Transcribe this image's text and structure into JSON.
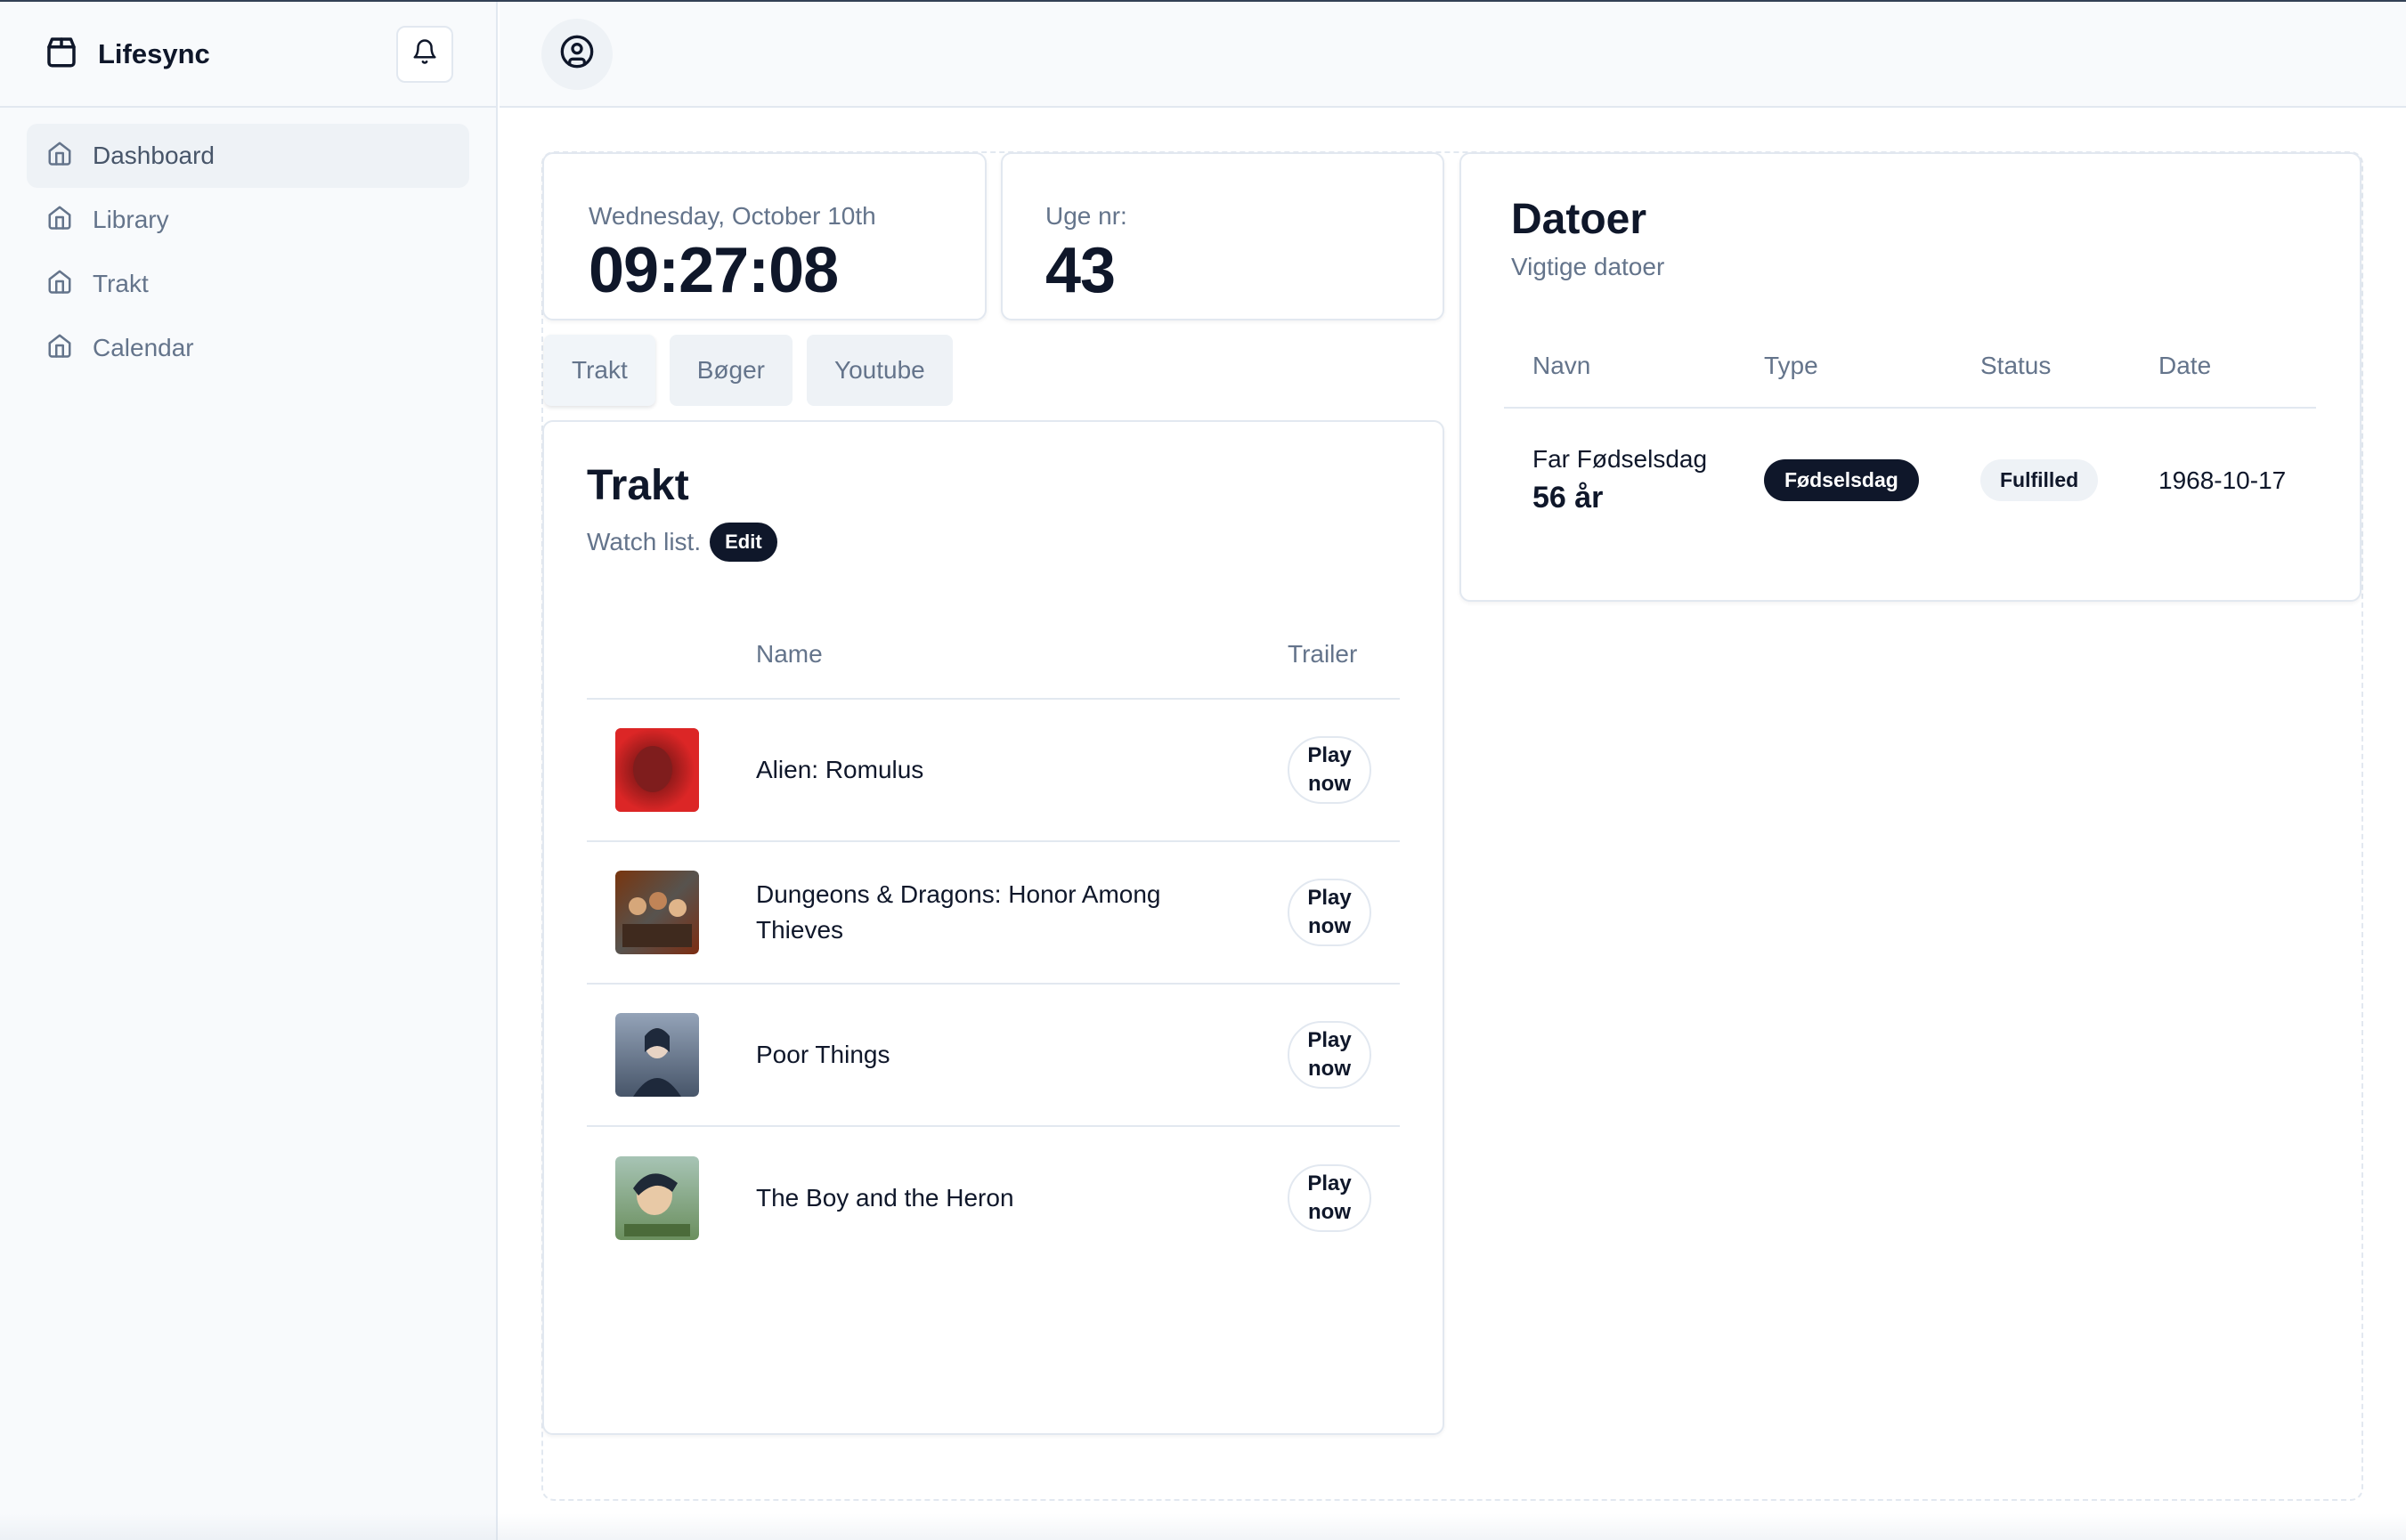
{
  "app": {
    "name": "Lifesync"
  },
  "sidebar": {
    "items": [
      {
        "label": "Dashboard",
        "icon": "home-icon",
        "active": true
      },
      {
        "label": "Library",
        "icon": "home-icon"
      },
      {
        "label": "Trakt",
        "icon": "home-icon"
      },
      {
        "label": "Calendar",
        "icon": "home-icon"
      }
    ]
  },
  "header": {
    "icons": [
      "bell-icon",
      "user-circle-icon"
    ]
  },
  "date_card": {
    "label": "Wednesday, October 10th",
    "time": "09:27:08"
  },
  "week_card": {
    "label": "Uge nr:",
    "value": "43"
  },
  "tabs": [
    {
      "label": "Trakt",
      "active": true
    },
    {
      "label": "Bøger"
    },
    {
      "label": "Youtube"
    }
  ],
  "trakt": {
    "title": "Trakt",
    "subtitle": "Watch list.",
    "edit_label": "Edit",
    "columns": {
      "name": "Name",
      "trailer": "Trailer"
    },
    "play_label_line1": "Play",
    "play_label_line2": "now",
    "rows": [
      {
        "name": "Alien: Romulus"
      },
      {
        "name": "Dungeons & Dragons: Honor Among Thieves"
      },
      {
        "name": "Poor Things"
      },
      {
        "name": "The Boy and the Heron"
      }
    ]
  },
  "datoer": {
    "title": "Datoer",
    "subtitle": "Vigtige datoer",
    "columns": {
      "navn": "Navn",
      "type": "Type",
      "status": "Status",
      "date": "Date"
    },
    "rows": [
      {
        "navn": "Far Fødselsdag",
        "age": "56 år",
        "type": "Fødselsdag",
        "status": "Fulfilled",
        "date": "1968-10-17"
      }
    ]
  },
  "colors": {
    "primary": "#0f172a",
    "muted": "#64748b",
    "border": "#e2e8f0",
    "sidebar_bg": "#f8fafc"
  }
}
